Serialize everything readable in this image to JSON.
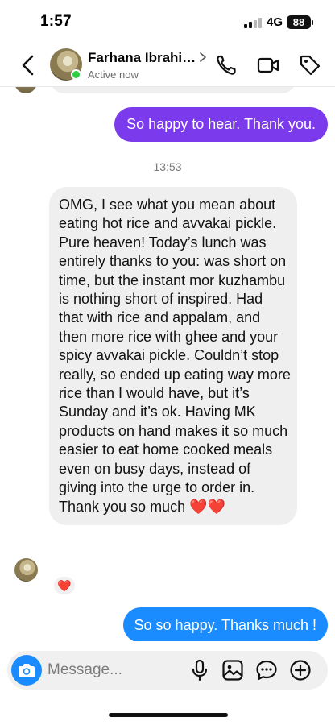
{
  "status_bar": {
    "time": "1:57",
    "network": "4G",
    "battery": "88"
  },
  "header": {
    "contact_name": "Farhana Ibrahi…",
    "contact_status": "Active now",
    "icons": [
      "back-chevron-icon",
      "phone-icon",
      "video-camera-icon",
      "tag-icon"
    ]
  },
  "messages": [
    {
      "direction": "outgoing",
      "text": "So happy to hear. Thank you.",
      "color": "#7c3aed"
    },
    {
      "type": "timestamp",
      "text": "13:53"
    },
    {
      "direction": "incoming",
      "text": "OMG, I see what you mean about eating hot rice and avvakai pickle. Pure heaven! Today’s lunch was entirely thanks to you: was short on time, but the instant mor kuzhambu is nothing short of inspired. Had that with rice and appalam, and then more rice with ghee and your spicy avvakai pickle. Couldn’t stop really, so ended up eating way more rice than I would have, but it’s Sunday and it’s ok. Having MK products on hand makes it so much easier to eat home cooked meals even on busy days, instead of giving into the urge to order in. Thank you so much ❤️❤️",
      "reaction": "❤️"
    },
    {
      "direction": "outgoing",
      "text": "So so happy. Thanks much !",
      "color": "#1a8cff"
    }
  ],
  "composer": {
    "placeholder": "Message...",
    "icons": [
      "camera-icon",
      "microphone-icon",
      "gallery-icon",
      "sticker-icon",
      "add-icon"
    ]
  },
  "colors": {
    "accent_purple": "#7c3aed",
    "accent_blue": "#1a8cff",
    "incoming_bubble": "#efefef",
    "online": "#2ecc40"
  }
}
